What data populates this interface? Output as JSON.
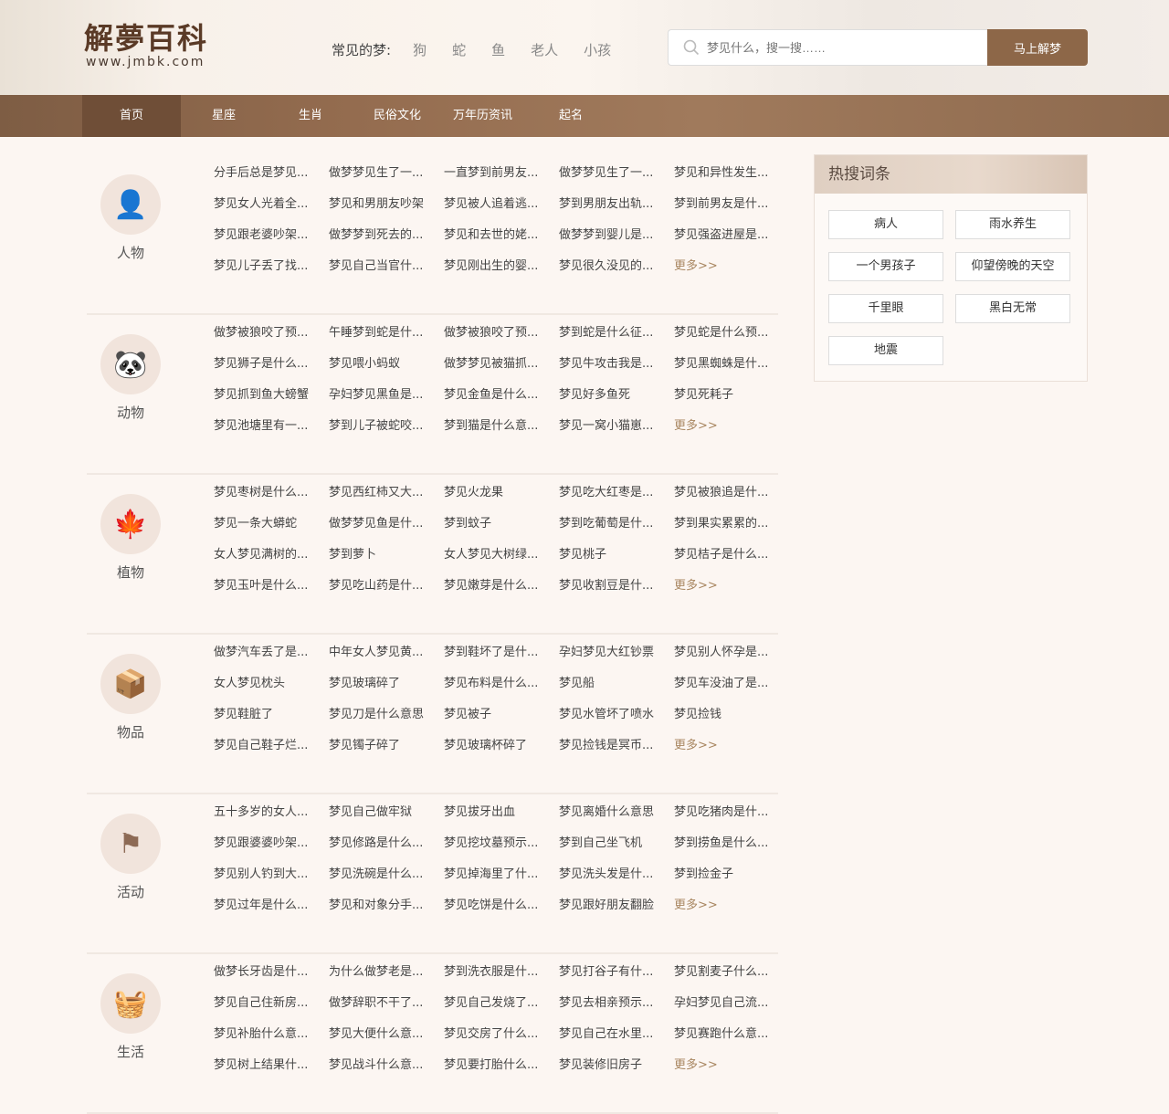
{
  "logo": {
    "title": "解夢百科",
    "url": "www.jmbk.com"
  },
  "common": {
    "label": "常见的梦:",
    "items": [
      "狗",
      "蛇",
      "鱼",
      "老人",
      "小孩"
    ]
  },
  "search": {
    "placeholder": "梦见什么，搜一搜……",
    "button": "马上解梦"
  },
  "nav": [
    "首页",
    "星座",
    "生肖",
    "民俗文化",
    "万年历资讯",
    "起名"
  ],
  "sections": [
    {
      "name": "人物",
      "icon": "person-icon",
      "glyph": "👤",
      "items": [
        "分手后总是梦见...",
        "做梦梦见生了一...",
        "一直梦到前男友...",
        "做梦梦见生了一...",
        "梦见和异性发生...",
        "梦见女人光着全...",
        "梦见和男朋友吵架",
        "梦见被人追着逃...",
        "梦到男朋友出轨...",
        "梦到前男友是什...",
        "梦见跟老婆吵架...",
        "做梦梦到死去的...",
        "梦见和去世的姥...",
        "做梦梦到婴儿是...",
        "梦见强盗进屋是...",
        "梦见儿子丢了找...",
        "梦见自己当官什...",
        "梦见刚出生的婴...",
        "梦见很久没见的..."
      ],
      "more": "更多>>"
    },
    {
      "name": "动物",
      "icon": "panda-icon",
      "glyph": "🐼",
      "items": [
        "做梦被狼咬了预...",
        "午睡梦到蛇是什...",
        "做梦被狼咬了预...",
        "梦到蛇是什么征...",
        "梦见蛇是什么预...",
        "梦见狮子是什么...",
        "梦见喂小蚂蚁",
        "做梦梦见被猫抓...",
        "梦见牛攻击我是...",
        "梦见黑蜘蛛是什...",
        "梦见抓到鱼大螃蟹",
        "孕妇梦见黑鱼是...",
        "梦见金鱼是什么...",
        "梦见好多鱼死",
        "梦见死耗子",
        "梦见池塘里有一...",
        "梦到儿子被蛇咬...",
        "梦到猫是什么意...",
        "梦见一窝小猫崽..."
      ],
      "more": "更多>>"
    },
    {
      "name": "植物",
      "icon": "maple-leaf-icon",
      "glyph": "🍁",
      "items": [
        "梦见枣树是什么...",
        "梦见西红柿又大...",
        "梦见火龙果",
        "梦见吃大红枣是...",
        "梦见被狼追是什...",
        "梦见一条大蟒蛇",
        "做梦梦见鱼是什...",
        "梦到蚊子",
        "梦到吃葡萄是什...",
        "梦到果实累累的...",
        "女人梦见满树的...",
        "梦到萝卜",
        "女人梦见大树绿...",
        "梦见桃子",
        "梦见桔子是什么...",
        "梦见玉叶是什么...",
        "梦见吃山药是什...",
        "梦见嫩芽是什么...",
        "梦见收割豆是什..."
      ],
      "more": "更多>>"
    },
    {
      "name": "物品",
      "icon": "box-icon",
      "glyph": "📦",
      "items": [
        "做梦汽车丢了是...",
        "中年女人梦见黄...",
        "梦到鞋坏了是什...",
        "孕妇梦见大红钞票",
        "梦见别人怀孕是...",
        "女人梦见枕头",
        "梦见玻璃碎了",
        "梦见布料是什么...",
        "梦见船",
        "梦见车没油了是...",
        "梦见鞋脏了",
        "梦见刀是什么意思",
        "梦见被子",
        "梦见水管坏了喷水",
        "梦见捡钱",
        "梦见自己鞋子烂...",
        "梦见镯子碎了",
        "梦见玻璃杯碎了",
        "梦见捡钱是冥币..."
      ],
      "more": "更多>>"
    },
    {
      "name": "活动",
      "icon": "flag-icon",
      "glyph": "⚑",
      "items": [
        "五十多岁的女人...",
        "梦见自己做牢狱",
        "梦见拔牙出血",
        "梦见离婚什么意思",
        "梦见吃猪肉是什...",
        "梦见跟婆婆吵架...",
        "梦见修路是什么...",
        "梦见挖坟墓预示...",
        "梦到自己坐飞机",
        "梦到捞鱼是什么...",
        "梦见别人钓到大...",
        "梦见洗碗是什么...",
        "梦见掉海里了什...",
        "梦见洗头发是什...",
        "梦到捡金子",
        "梦见过年是什么...",
        "梦见和对象分手...",
        "梦见吃饼是什么...",
        "梦见跟好朋友翻脸"
      ],
      "more": "更多>>"
    },
    {
      "name": "生活",
      "icon": "basket-icon",
      "glyph": "🧺",
      "items": [
        "做梦长牙齿是什...",
        "为什么做梦老是...",
        "梦到洗衣服是什...",
        "梦见打谷子有什...",
        "梦见割麦子什么...",
        "梦见自己住新房...",
        "做梦辞职不干了...",
        "梦见自己发烧了...",
        "梦见去相亲预示...",
        "孕妇梦见自己流...",
        "梦见补胎什么意...",
        "梦见大便什么意...",
        "梦见交房了什么...",
        "梦见自己在水里...",
        "梦见赛跑什么意...",
        "梦见树上结果什...",
        "梦见战斗什么意...",
        "梦见要打胎什么...",
        "梦见装修旧房子"
      ],
      "more": "更多>>"
    }
  ],
  "hot": {
    "title": "热搜词条",
    "tags": [
      "病人",
      "雨水养生",
      "一个男孩子",
      "仰望傍晚的天空",
      "千里眼",
      "黑白无常",
      "地震"
    ]
  },
  "colors": {
    "accent": "#8d6748",
    "nav": "#8b6446",
    "more": "#a88660"
  }
}
